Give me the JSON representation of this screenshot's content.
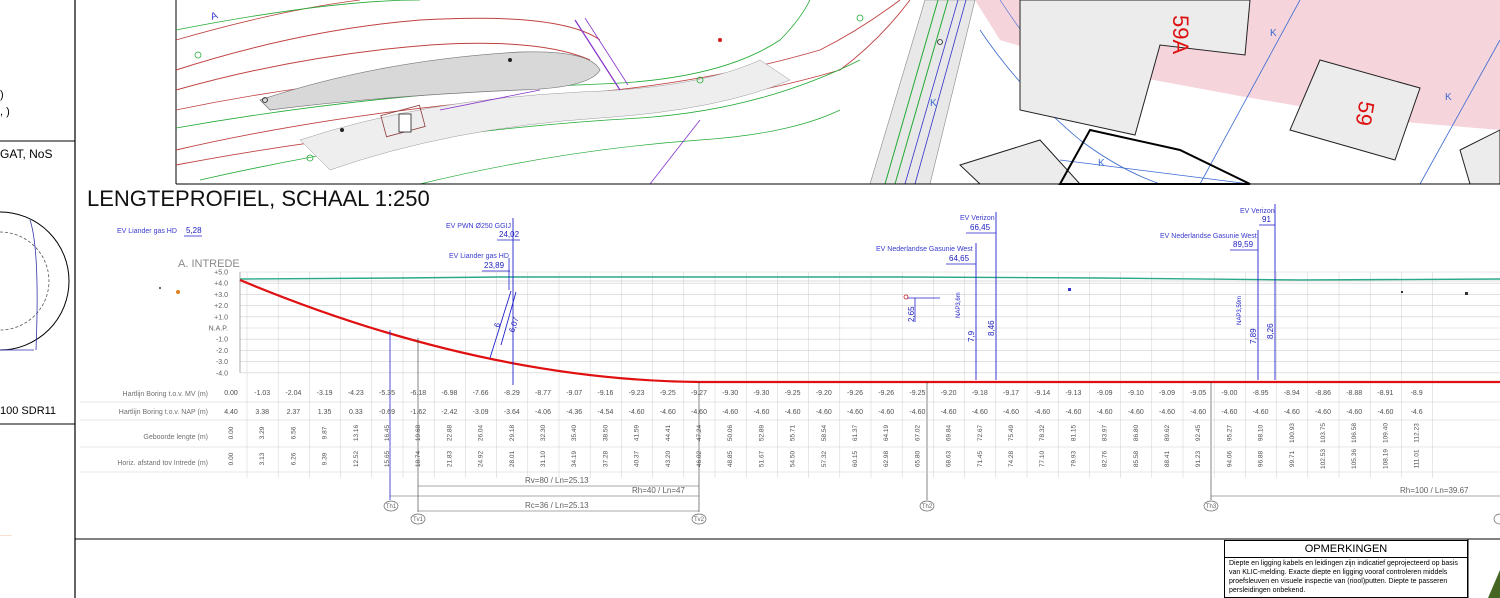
{
  "title": "LENGTEPROFIEL, SCHAAL 1:250",
  "left_panel": {
    "fragment_1": ")",
    "fragment_2": ", )",
    "fragment_3": "GAT, NoS",
    "fragment_4": "100 SDR11"
  },
  "map": {
    "house_labels": [
      "59A",
      "59"
    ],
    "k_marker": "K",
    "a_label": "A"
  },
  "profile": {
    "entry_label": "A. INTREDE",
    "axis_ticks": [
      "+5.0",
      "+4.0",
      "+3.0",
      "+2.0",
      "+1.0",
      "N.A.P.",
      "-1.0",
      "-2.0",
      "-3.0",
      "-4.0"
    ],
    "axis_values": [
      5,
      4,
      3,
      2,
      1,
      0,
      -1,
      -2,
      -3,
      -4
    ],
    "cables": [
      {
        "name": "EV Liander gas HD",
        "value": "5,28"
      },
      {
        "name": "EV PWN Ø250 GGIJ",
        "value": "24,02"
      },
      {
        "name": "EV Liander gas HD",
        "value": "23,89"
      },
      {
        "name": "EV Verizon",
        "value": "66,45"
      },
      {
        "name": "EV Nederlandse Gasunie West",
        "value": "64,65"
      },
      {
        "name": "EV Verizon",
        "value": "91"
      },
      {
        "name": "EV Nederlandse Gasunie West",
        "value": "89,59"
      }
    ],
    "depth_marks": [
      {
        "label": "6",
        "value": "6,07"
      },
      {
        "label": "2,65"
      },
      {
        "label": "NAP3,6m",
        "a": "7,9",
        "b": "8,46"
      },
      {
        "label": "NAP3,59m",
        "a": "7,89",
        "b": "8,26"
      }
    ],
    "row_labels": [
      "Hartlijn Boring t.o.v. MV (m)",
      "Hartlijn Boring t.o.v. NAP (m)",
      "Geboorde lengte (m)",
      "Horiz. afstand tov Intrede (m)"
    ],
    "row_mv": [
      "0.00",
      "-1.03",
      "-2.04",
      "-3.19",
      "-4.23",
      "-5.35",
      "-6.18",
      "-6.98",
      "-7.66",
      "-8.29",
      "-8.77",
      "-9.07",
      "-9.16",
      "-9.23",
      "-9.25",
      "-9.27",
      "-9.30",
      "-9.30",
      "-9.25",
      "-9.20",
      "-9.26",
      "-9.26",
      "-9.25",
      "-9.20",
      "-9.18",
      "-9.17",
      "-9.14",
      "-9.13",
      "-9.09",
      "-9.10",
      "-9.09",
      "-9.05",
      "-9.00",
      "-8.95",
      "-8.94",
      "-8.86",
      "-8.88",
      "-8.91",
      "-8.9"
    ],
    "row_nap": [
      "4.40",
      "3.38",
      "2.37",
      "1.35",
      "0.33",
      "-0.69",
      "-1.62",
      "-2.42",
      "-3.09",
      "-3.64",
      "-4.06",
      "-4.36",
      "-4.54",
      "-4.60",
      "-4.60",
      "-4.60",
      "-4.60",
      "-4.60",
      "-4.60",
      "-4.60",
      "-4.60",
      "-4.60",
      "-4.60",
      "-4.60",
      "-4.60",
      "-4.60",
      "-4.60",
      "-4.60",
      "-4.60",
      "-4.60",
      "-4.60",
      "-4.60",
      "-4.60",
      "-4.60",
      "-4.60",
      "-4.60",
      "-4.60",
      "-4.60",
      "-4.6"
    ],
    "row_length": [
      "0.00",
      "3.29",
      "6.56",
      "9.87",
      "13.16",
      "16.45",
      "19.68",
      "22.88",
      "26.04",
      "29.18",
      "32.30",
      "35.40",
      "38.50",
      "41.59",
      "44.41",
      "47.24",
      "50.06",
      "52.89",
      "55.71",
      "58.54",
      "61.37",
      "64.19",
      "67.02",
      "69.84",
      "72.67",
      "75.49",
      "78.32",
      "81.15",
      "83.97",
      "86.80",
      "89.62",
      "92.45",
      "95.27",
      "98.10",
      "100.93",
      "103.75",
      "106.58",
      "109.40",
      "112.23"
    ],
    "row_horiz": [
      "0.00",
      "3.13",
      "6.26",
      "9.39",
      "12.52",
      "15.65",
      "18.74",
      "21.83",
      "24.92",
      "28.01",
      "31.10",
      "34.19",
      "37.28",
      "40.37",
      "43.20",
      "46.02",
      "48.85",
      "51.67",
      "54.50",
      "57.32",
      "60.15",
      "62.98",
      "65.80",
      "68.63",
      "71.45",
      "74.28",
      "77.10",
      "79.93",
      "82.76",
      "85.58",
      "88.41",
      "91.23",
      "94.06",
      "96.88",
      "99.71",
      "102.53",
      "105.36",
      "108.19",
      "111.01"
    ],
    "bends": [
      {
        "text": "Rv=80 / Ln=25.13"
      },
      {
        "text": "Rh=40 / Ln=47"
      },
      {
        "text": "Rc=36 / Ln=25.13"
      },
      {
        "text": "Rh=100 / Ln=39.67"
      }
    ],
    "markers": [
      "Th1",
      "Tv1",
      "Tv2",
      "Th2",
      "Th3"
    ]
  },
  "remarks": {
    "title": "OPMERKINGEN",
    "text": "Diepte en ligging kabels en leidingen zijn indicatief geprojecteerd op basis van KLIC-melding. Exacte diepte en ligging vooraf controleren middels proefsleuven en visuele inspectie van (riool)putten. Diepte te passeren persleidingen onbekend."
  },
  "colors": {
    "bore_line": "#e01010",
    "cable": "#2222cc",
    "ground": "#2aa98a",
    "grid": "#c8c8c8",
    "map_parcel": "#f6d4dc"
  }
}
